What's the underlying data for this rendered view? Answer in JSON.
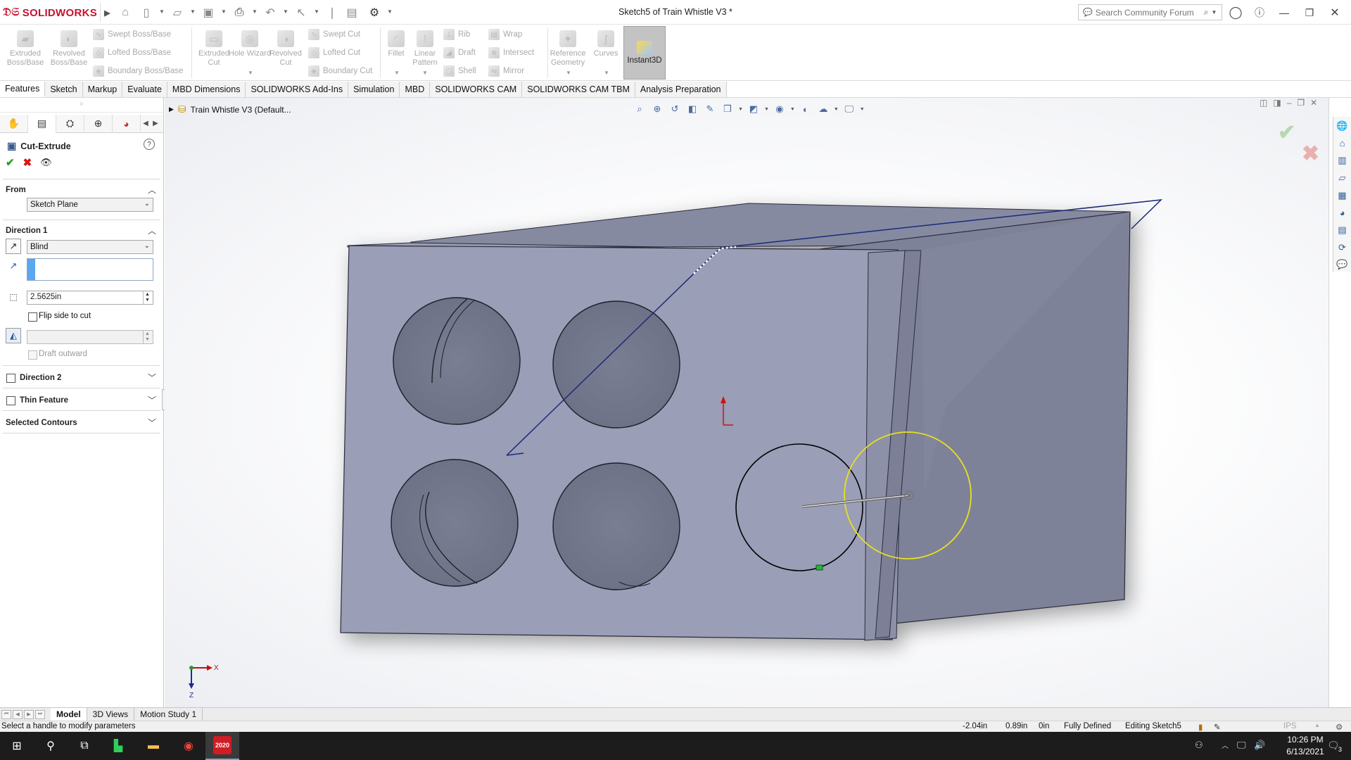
{
  "app": {
    "brand": "SOLIDWORKS",
    "document_title": "Sketch5 of Train Whistle V3 *",
    "search_placeholder": "Search Community Forum"
  },
  "ribbon": {
    "extruded_boss": "Extruded Boss/Base",
    "revolved_boss": "Revolved Boss/Base",
    "swept_boss": "Swept Boss/Base",
    "lofted_boss": "Lofted Boss/Base",
    "boundary_boss": "Boundary Boss/Base",
    "extruded_cut": "Extruded Cut",
    "hole_wizard": "Hole Wizard",
    "revolved_cut": "Revolved Cut",
    "swept_cut": "Swept Cut",
    "lofted_cut": "Lofted Cut",
    "boundary_cut": "Boundary Cut",
    "fillet": "Fillet",
    "linear_pattern": "Linear Pattern",
    "rib": "Rib",
    "draft": "Draft",
    "shell": "Shell",
    "wrap": "Wrap",
    "intersect": "Intersect",
    "mirror": "Mirror",
    "reference_geometry": "Reference Geometry",
    "curves": "Curves",
    "instant3d": "Instant3D"
  },
  "command_tabs": [
    "Features",
    "Sketch",
    "Markup",
    "Evaluate",
    "MBD Dimensions",
    "SOLIDWORKS Add-Ins",
    "Simulation",
    "MBD",
    "SOLIDWORKS CAM",
    "SOLIDWORKS CAM TBM",
    "Analysis Preparation"
  ],
  "property_manager": {
    "title": "Cut-Extrude",
    "help": "?",
    "from": {
      "label": "From",
      "value": "Sketch Plane"
    },
    "direction1": {
      "label": "Direction 1",
      "end_condition": "Blind",
      "depth": "2.5625in",
      "flip_side_label": "Flip side to cut",
      "draft_outward_label": "Draft outward"
    },
    "direction2_label": "Direction 2",
    "thin_feature_label": "Thin Feature",
    "selected_contours_label": "Selected Contours"
  },
  "graphics": {
    "tree_root": "Train Whistle V3  (Default...",
    "triad_x": "X",
    "triad_z": "Z"
  },
  "bottom_tabs": [
    "Model",
    "3D Views",
    "Motion Study 1"
  ],
  "status": {
    "hint": "Select a handle to modify parameters",
    "x": "-2.04in",
    "y": "0.89in",
    "z": "0in",
    "state": "Fully Defined",
    "editing": "Editing Sketch5",
    "units": "IPS"
  },
  "taskbar": {
    "time": "10:26 PM",
    "date": "6/13/2021",
    "notifications": "3",
    "sw_label": "2020"
  },
  "colors": {
    "brand_red": "#c8102e",
    "model_face": "#8a8fa8",
    "sketch_selected": "#e8e020",
    "sketch_line": "#000000",
    "plane_edge": "#1a2a7a"
  }
}
